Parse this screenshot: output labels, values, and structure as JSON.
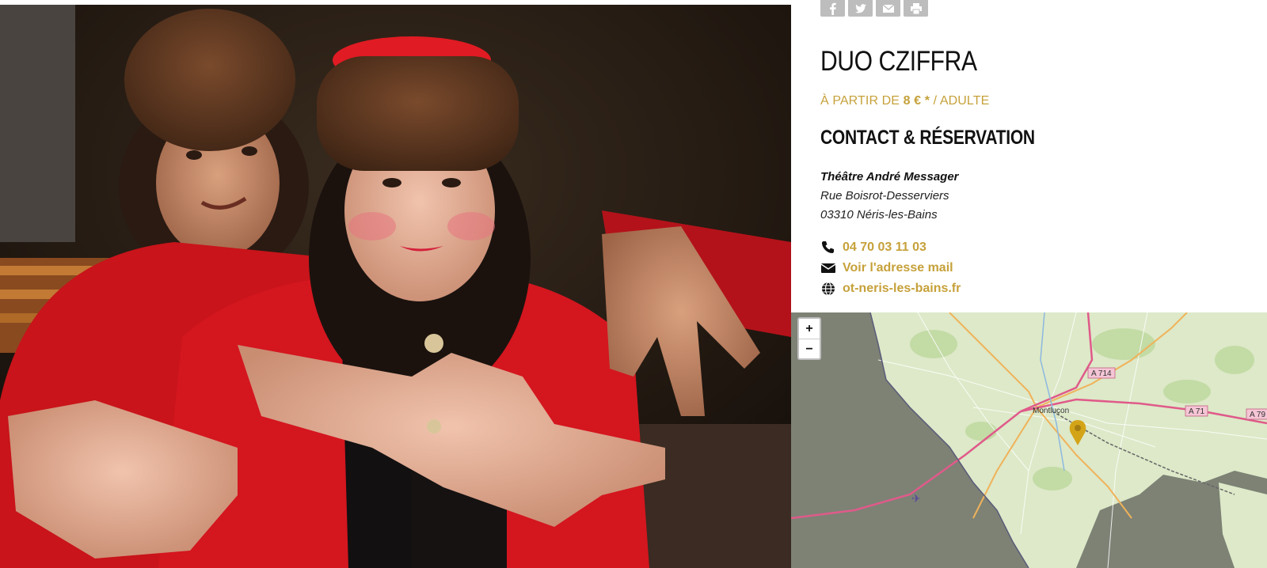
{
  "share": {
    "buttons": [
      {
        "name": "facebook-share-button",
        "icon": "facebook-icon"
      },
      {
        "name": "twitter-share-button",
        "icon": "twitter-icon"
      },
      {
        "name": "email-share-button",
        "icon": "envelope-icon"
      },
      {
        "name": "print-button",
        "icon": "print-icon"
      }
    ]
  },
  "event": {
    "title": "DUO CZIFFRA",
    "price_prefix": "À PARTIR DE",
    "price_value": "8 € *",
    "price_suffix": "/ ADULTE"
  },
  "contact": {
    "heading": "CONTACT & RÉSERVATION",
    "venue_name": "Théâtre André Messager",
    "street": "Rue Boisrot-Desserviers",
    "city": "03310 Néris-les-Bains",
    "phone": "04 70 03 11 03",
    "email_label": "Voir l'adresse mail",
    "website": "ot-neris-les-bains.fr"
  },
  "map": {
    "zoom_in": "+",
    "zoom_out": "−",
    "labels": {
      "city": "Montluçon",
      "road_a714": "A 714",
      "road_a71": "A 71",
      "road_a79": "A 79"
    },
    "marker_color": "#d4a418"
  },
  "colors": {
    "accent": "#c6a13a",
    "text": "#111111"
  }
}
